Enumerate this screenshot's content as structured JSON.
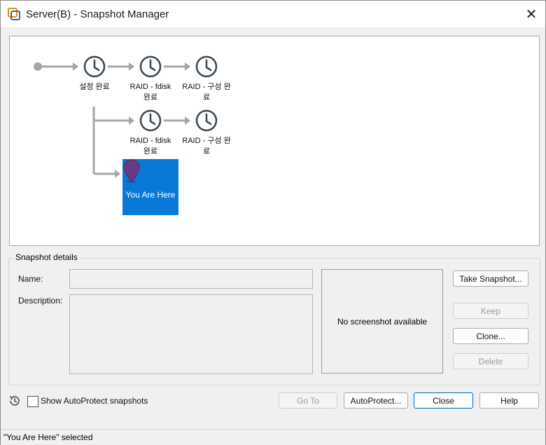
{
  "window": {
    "title": "Server(B) - Snapshot Manager",
    "close_glyph": "✕",
    "app_icon": "vmware-icon"
  },
  "tree": {
    "nodes": [
      {
        "label_line1": "설정 완료",
        "label_line2": ""
      },
      {
        "label_line1": "RAID - fdisk",
        "label_line2": "완료"
      },
      {
        "label_line1": "RAID - 구성 완",
        "label_line2": "료"
      },
      {
        "label_line1": "RAID - fdisk",
        "label_line2": "완료"
      },
      {
        "label_line1": "RAID - 구성 완",
        "label_line2": "료"
      }
    ],
    "current": {
      "label": "You Are Here",
      "selected_color": "#0a78d7"
    }
  },
  "details": {
    "legend": "Snapshot details",
    "name_label": "Name:",
    "name_value": "",
    "description_label": "Description:",
    "description_value": "",
    "screenshot_text": "No screenshot available"
  },
  "buttons": {
    "take_snapshot": "Take Snapshot...",
    "keep": "Keep",
    "clone": "Clone...",
    "delete": "Delete",
    "go_to": "Go To",
    "autoprotect": "AutoProtect...",
    "close": "Close",
    "help": "Help"
  },
  "bottom": {
    "show_autoprotect_label": "Show AutoProtect snapshots",
    "show_autoprotect_checked": false
  },
  "status": {
    "text": "\"You Are Here\" selected"
  }
}
